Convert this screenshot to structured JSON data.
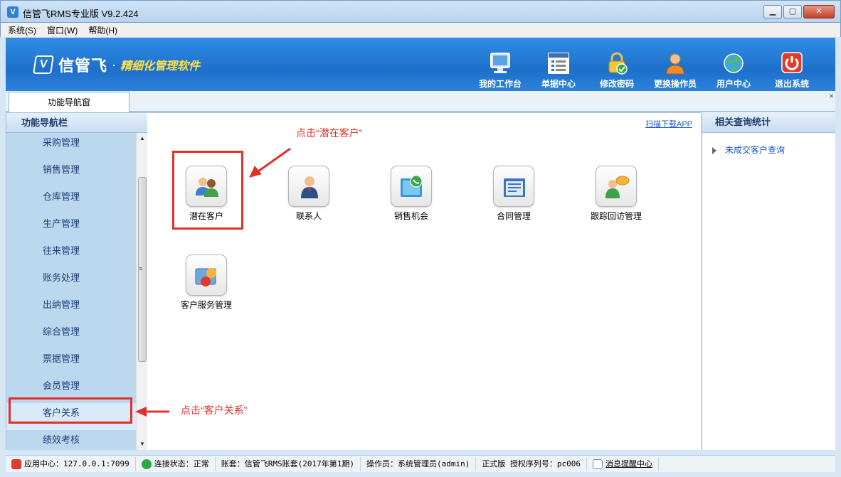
{
  "window": {
    "title": "信管飞RMS专业版 V9.2.424",
    "app_icon": "app-logo-icon"
  },
  "menu": [
    "系统(S)",
    "窗口(W)",
    "帮助(H)"
  ],
  "banner": {
    "logo_mark": "V",
    "logo_name": "信管飞",
    "tagline": "精细化管理软件",
    "tools": [
      {
        "label": "我的工作台",
        "icon": "monitor-icon"
      },
      {
        "label": "单据中心",
        "icon": "document-list-icon"
      },
      {
        "label": "修改密码",
        "icon": "lock-icon"
      },
      {
        "label": "更换操作员",
        "icon": "user-icon"
      },
      {
        "label": "用户中心",
        "icon": "globe-icon"
      },
      {
        "label": "退出系统",
        "icon": "power-icon"
      }
    ]
  },
  "tab": {
    "label": "功能导航窗",
    "close": "×"
  },
  "nav": {
    "header": "功能导航栏",
    "items": [
      "采购管理",
      "销售管理",
      "仓库管理",
      "生产管理",
      "往来管理",
      "账务处理",
      "出纳管理",
      "综合管理",
      "票据管理",
      "会员管理",
      "客户关系",
      "绩效考核"
    ],
    "active": "客户关系"
  },
  "main": {
    "download_link": "扫描下载APP",
    "modules": [
      {
        "label": "潜在客户",
        "icon": "potential-customer-icon"
      },
      {
        "label": "联系人",
        "icon": "contact-icon"
      },
      {
        "label": "销售机会",
        "icon": "sales-opportunity-icon"
      },
      {
        "label": "合同管理",
        "icon": "contract-icon"
      },
      {
        "label": "跟踪回访管理",
        "icon": "follow-up-icon"
      },
      {
        "label": "客户服务管理",
        "icon": "customer-service-icon"
      }
    ]
  },
  "right_panel": {
    "header": "相关查询统计",
    "items": [
      "未成交客户查询"
    ]
  },
  "annotations": {
    "click_potential": "点击“潜在客户”",
    "click_crm": "点击“客户关系”"
  },
  "status": {
    "app_center": "应用中心：127.0.0.1:7099",
    "connection": "连接状态：正常",
    "account": "账套：信管飞RMS账套(2017年第1期)",
    "operator": "操作员：系统管理员(admin)",
    "license": "正式版 授权序列号：pc006",
    "messages": "消息提醒中心"
  },
  "colors": {
    "banner": "#1e6fca",
    "annotation": "#e0302a",
    "nav_bg": "#bcd8ef",
    "link": "#1a56c4"
  }
}
